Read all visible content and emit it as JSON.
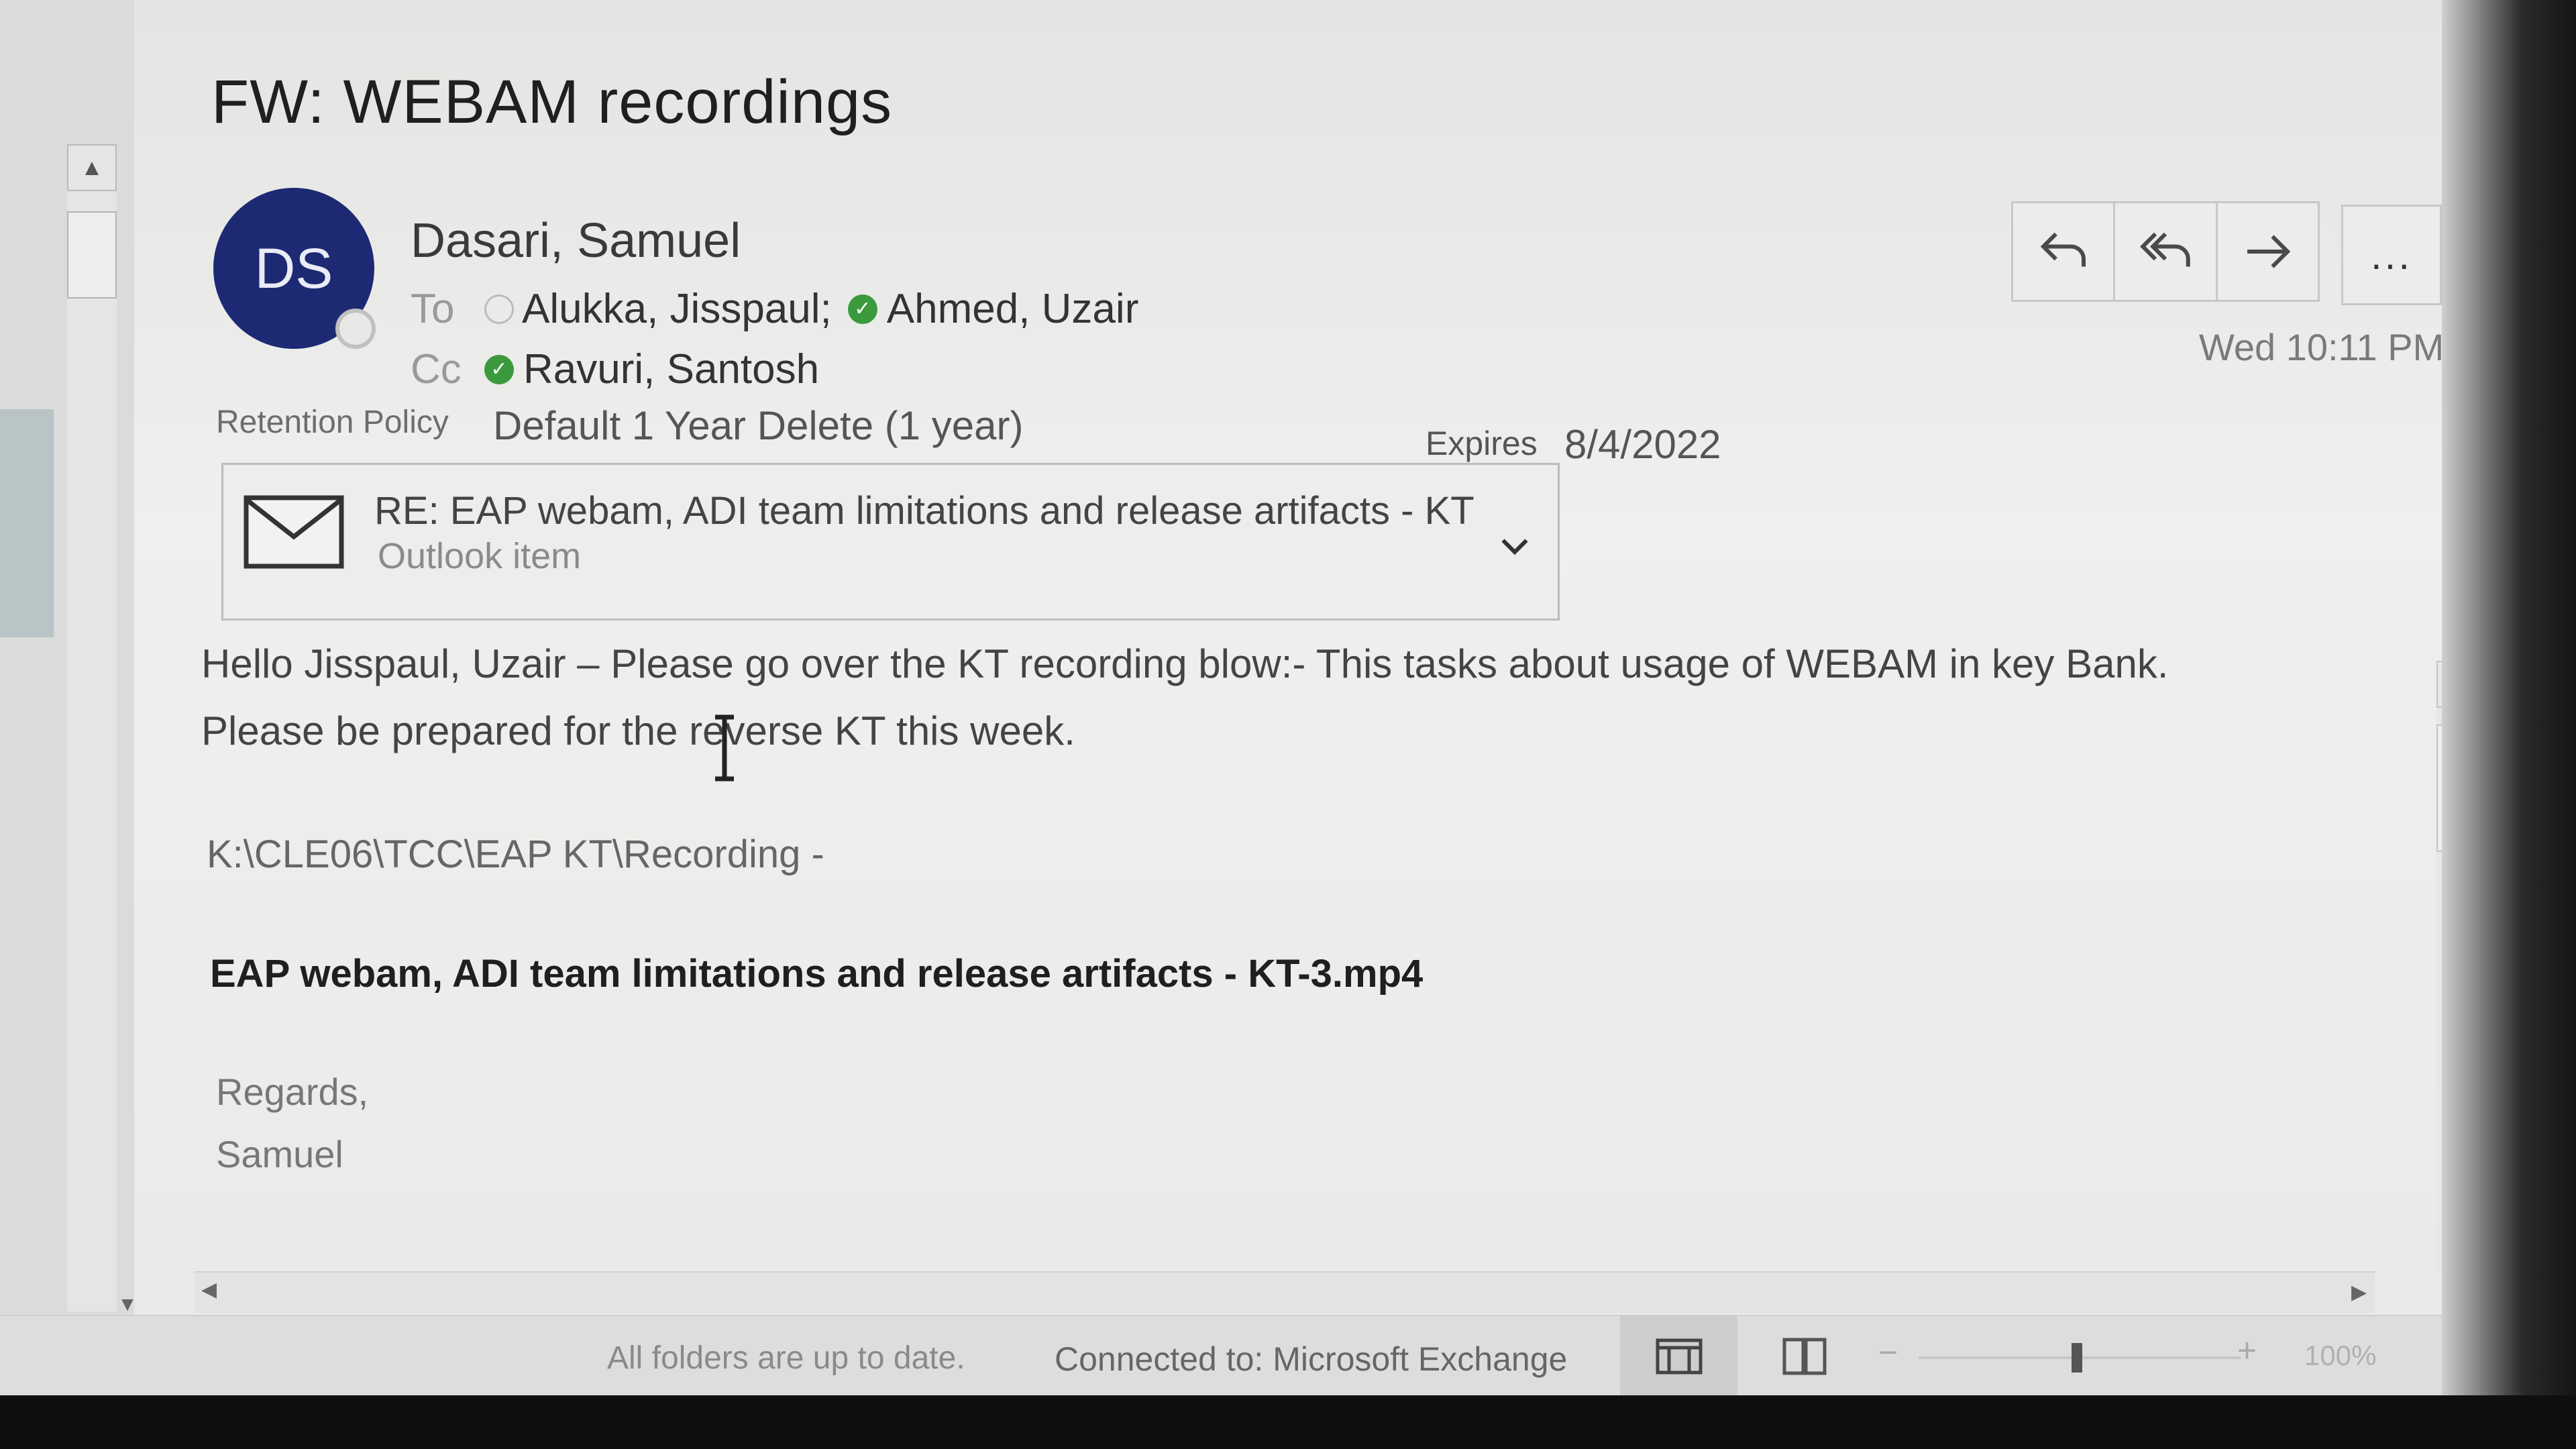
{
  "email": {
    "subject": "FW: WEBAM recordings",
    "avatar_initials": "DS",
    "sender": "Dasari, Samuel",
    "to_label": "To",
    "to_recipients": [
      "Alukka, Jisspaul;",
      "Ahmed, Uzair"
    ],
    "cc_label": "Cc",
    "cc_recipients": [
      "Ravuri, Santosh"
    ],
    "retention_label": "Retention Policy",
    "retention_value": "Default 1 Year Delete (1 year)",
    "expires_label": "Expires",
    "expires_value": "8/4/2022",
    "received_time": "Wed 10:11 PM",
    "attachment": {
      "title": "RE: EAP webam, ADI team limitations and release artifacts - KT",
      "subtitle": "Outlook item"
    },
    "body": {
      "line1": "Hello Jisspaul, Uzair – Please go over the  KT recording blow:- This tasks about usage of WEBAM in key Bank.",
      "line2": "Please be prepared  for the reverse  KT this week.",
      "path": "K:\\CLE06\\TCC\\EAP KT\\Recording  -",
      "file": "EAP webam, ADI team limitations and release artifacts - KT-3.mp4",
      "regards": "Regards,",
      "signoff": "Samuel"
    }
  },
  "actions": {
    "reply_icon": "reply-icon",
    "reply_all_icon": "reply-all-icon",
    "forward_icon": "forward-icon",
    "more_label": "..."
  },
  "status_bar": {
    "sync_status": "All folders are up to date.",
    "connection_status": "Connected to: Microsoft Exchange",
    "zoom_minus": "−",
    "zoom_plus": "+",
    "zoom_level": "100%"
  },
  "colors": {
    "avatar_bg": "#1d2a73",
    "presence_available": "#3b9a3e"
  }
}
